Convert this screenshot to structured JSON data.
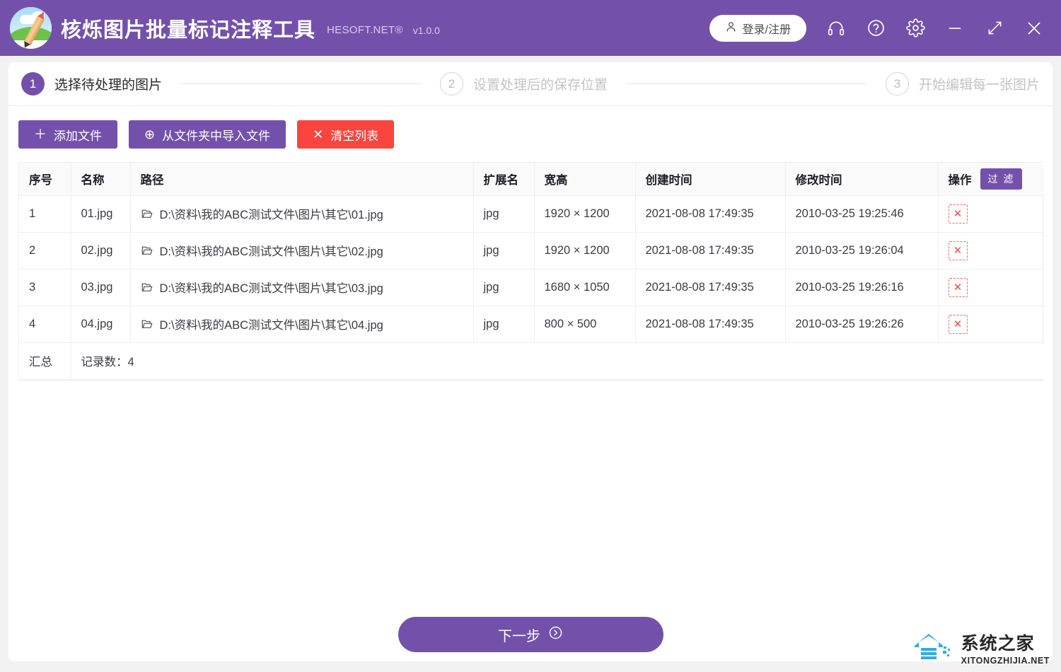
{
  "titlebar": {
    "app_title": "核烁图片批量标记注释工具",
    "brand": "HESOFT.NET®",
    "version": "v1.0.0",
    "login_label": "登录/注册",
    "icons": {
      "user": "user-icon",
      "headset": "headset-icon",
      "help": "question-circle-icon",
      "settings": "gear-icon",
      "minimize": "minimize-icon",
      "maximize": "expand-icon",
      "close": "close-icon"
    },
    "accent_color": "#7351ab"
  },
  "steps": [
    {
      "num": "1",
      "label": "选择待处理的图片",
      "state": "active"
    },
    {
      "num": "2",
      "label": "设置处理后的保存位置",
      "state": "inactive"
    },
    {
      "num": "3",
      "label": "开始编辑每一张图片",
      "state": "inactive"
    }
  ],
  "toolbar": {
    "add_files": {
      "icon": "plus-icon",
      "glyph": "＋",
      "label": "添加文件",
      "color": "#7351ab"
    },
    "import_folder": {
      "icon": "plus-circle-icon",
      "glyph": "⊕",
      "label": "从文件夹中导入文件",
      "color": "#7351ab"
    },
    "clear_list": {
      "icon": "close-icon",
      "glyph": "✕",
      "label": "清空列表",
      "color": "#f9453e"
    }
  },
  "table": {
    "headers": {
      "index": "序号",
      "name": "名称",
      "path": "路径",
      "ext": "扩展名",
      "size": "宽高",
      "ctime": "创建时间",
      "mtime": "修改时间",
      "action": "操作"
    },
    "filter_label": "过 滤",
    "delete_glyph": "✕",
    "rows": [
      {
        "index": "1",
        "name": "01.jpg",
        "path": "D:\\资料\\我的ABC测试文件\\图片\\其它\\01.jpg",
        "ext": "jpg",
        "size": "1920 × 1200",
        "ctime": "2021-08-08 17:49:35",
        "mtime": "2010-03-25 19:25:46"
      },
      {
        "index": "2",
        "name": "02.jpg",
        "path": "D:\\资料\\我的ABC测试文件\\图片\\其它\\02.jpg",
        "ext": "jpg",
        "size": "1920 × 1200",
        "ctime": "2021-08-08 17:49:35",
        "mtime": "2010-03-25 19:26:04"
      },
      {
        "index": "3",
        "name": "03.jpg",
        "path": "D:\\资料\\我的ABC测试文件\\图片\\其它\\03.jpg",
        "ext": "jpg",
        "size": "1680 × 1050",
        "ctime": "2021-08-08 17:49:35",
        "mtime": "2010-03-25 19:26:16"
      },
      {
        "index": "4",
        "name": "04.jpg",
        "path": "D:\\资料\\我的ABC测试文件\\图片\\其它\\04.jpg",
        "ext": "jpg",
        "size": "800 × 500",
        "ctime": "2021-08-08 17:49:35",
        "mtime": "2010-03-25 19:26:26"
      }
    ],
    "summary": {
      "label": "汇总",
      "count_text": "记录数：4"
    }
  },
  "footer": {
    "next_label": "下一步",
    "next_icon": "arrow-right-circle-icon"
  },
  "watermark": {
    "cn": "系统之家",
    "en": "XITONGZHIJIA.NET",
    "icon": "house-logo-icon"
  }
}
